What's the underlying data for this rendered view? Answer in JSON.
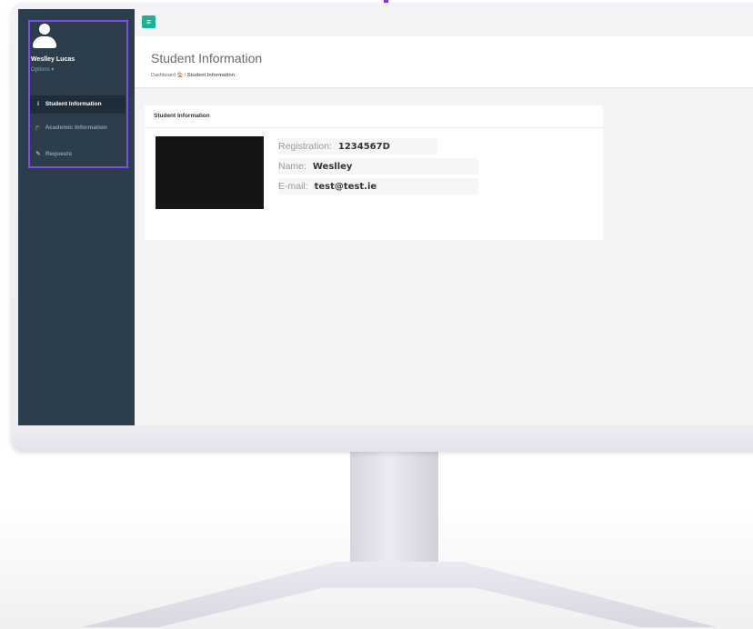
{
  "sidebar": {
    "user_name": "Weslley Lucas",
    "options_label": "Options ▾",
    "items": [
      {
        "label": "Student Information",
        "icon": "info-icon",
        "glyph": "i"
      },
      {
        "label": "Academic Information",
        "icon": "graduation-cap-icon",
        "glyph": "🎓"
      },
      {
        "label": "Requests",
        "icon": "pencil-icon",
        "glyph": "✎"
      }
    ]
  },
  "topbar": {
    "menu_icon": "hamburger-icon",
    "menu_glyph": "≡"
  },
  "header": {
    "title": "Student Information",
    "breadcrumb": {
      "home": "Dashboard",
      "home_icon": "🏠",
      "separator": "/",
      "current": "Student Information"
    }
  },
  "panel": {
    "title": "Student Information",
    "fields": [
      {
        "label": "Registration:",
        "value": "1234567D"
      },
      {
        "label": "Name:",
        "value": "Weslley"
      },
      {
        "label": "E-mail:",
        "value": "test@test.ie"
      }
    ]
  },
  "colors": {
    "accent": "#7b3fd8",
    "brand_green": "#1ab394",
    "sidebar_bg": "#2c3e4b"
  }
}
